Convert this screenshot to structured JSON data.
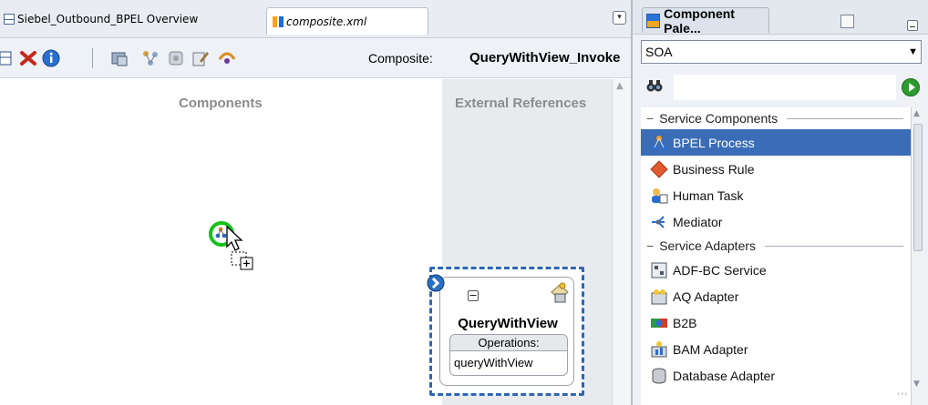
{
  "editor": {
    "tabs": [
      {
        "label": "Siebel_Outbound_BPEL Overview",
        "icon": "overview-doc-icon"
      },
      {
        "label": "composite.xml",
        "icon": "composite-icon"
      }
    ],
    "tabs_menu_icon": "dropdown-arrow-icon"
  },
  "toolbar": {
    "buttons": [
      "add-icon",
      "delete-icon",
      "info-icon",
      "deploy-icon",
      "structure-icon",
      "test-icon",
      "edit-icon",
      "wire-icon"
    ],
    "composite_caption": "Composite:",
    "composite_name": "QueryWithView_Invoke"
  },
  "canvas": {
    "components_title": "Components",
    "references_title": "External References",
    "reference": {
      "name": "QueryWithView",
      "operations_header": "Operations:",
      "operation": "queryWithView"
    },
    "colors": {
      "drop_ring": "#16c21a",
      "selection_border": "#2d67b4",
      "references_lane": "#e8eaee"
    }
  },
  "palette": {
    "tab_label": "Component Pale...",
    "category": "SOA",
    "search_placeholder": "",
    "sections": [
      {
        "title": "Service Components",
        "items": [
          {
            "label": "BPEL Process",
            "icon": "bpel-process-icon",
            "selected": true
          },
          {
            "label": "Business Rule",
            "icon": "business-rule-icon"
          },
          {
            "label": "Human Task",
            "icon": "human-task-icon"
          },
          {
            "label": "Mediator",
            "icon": "mediator-icon"
          }
        ]
      },
      {
        "title": "Service Adapters",
        "items": [
          {
            "label": "ADF-BC Service",
            "icon": "adf-bc-service-icon"
          },
          {
            "label": "AQ Adapter",
            "icon": "aq-adapter-icon"
          },
          {
            "label": "B2B",
            "icon": "b2b-icon"
          },
          {
            "label": "BAM Adapter",
            "icon": "bam-adapter-icon"
          },
          {
            "label": "Database Adapter",
            "icon": "database-adapter-icon"
          }
        ]
      }
    ],
    "colors": {
      "selection": "#3b6db7"
    }
  }
}
